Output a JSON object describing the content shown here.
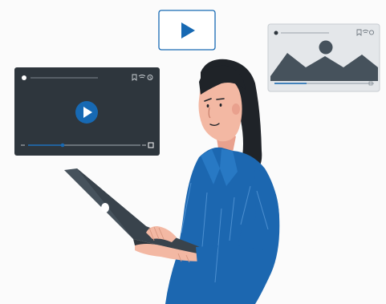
{
  "colors": {
    "background": "#fbfbfb",
    "accent_blue": "#1769b3",
    "dark_player": "#2e363d",
    "card_grey": "#e4e7ea",
    "laptop": "#46525c",
    "hair": "#1f2328",
    "skin": "#f3b8a3",
    "shirt": "#1c67b0"
  },
  "icons": [
    "play-icon",
    "mountain-image-icon",
    "sun-icon",
    "bookmark-icon",
    "wifi-icon",
    "clock-icon",
    "fullscreen-icon",
    "apple-logo-icon"
  ],
  "dark_player": {
    "progress": 0.33
  },
  "image_card": {
    "progress": 0.32
  }
}
